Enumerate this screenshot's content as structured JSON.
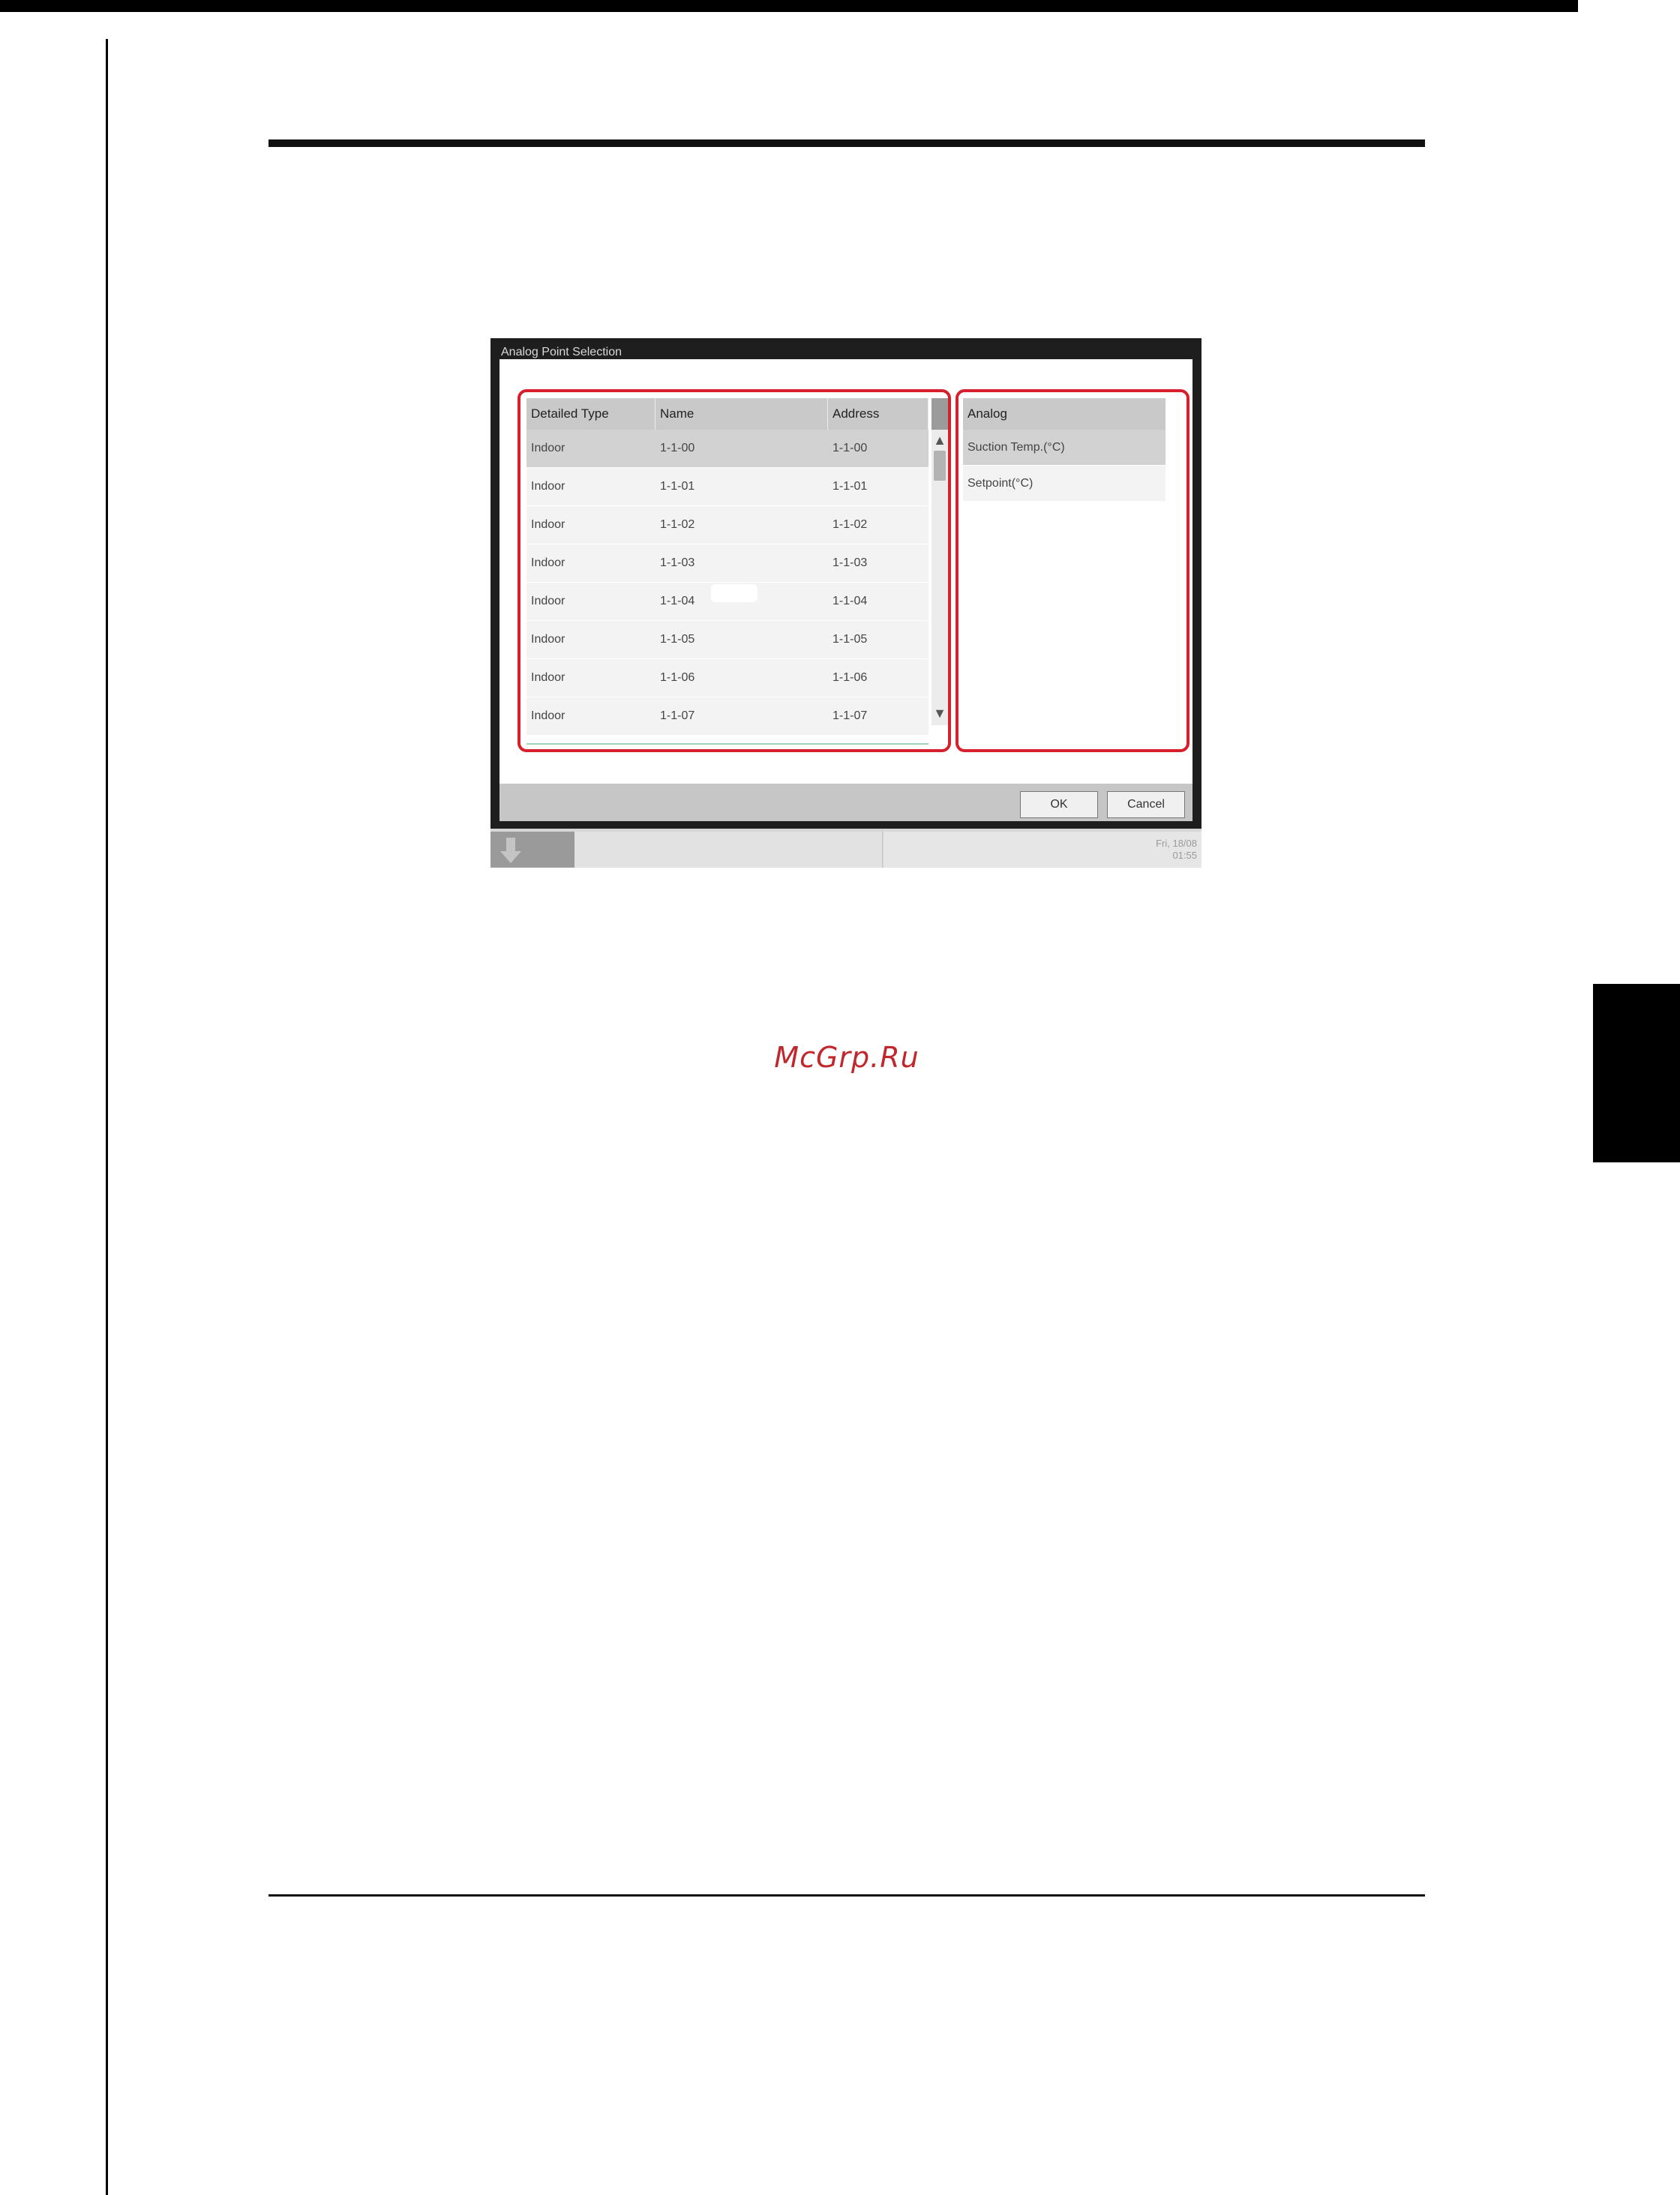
{
  "watermark": "McGrp.Ru",
  "dialog": {
    "title": "Analog Point Selection",
    "table": {
      "columns": [
        "Detailed Type",
        "Name",
        "Address"
      ],
      "rows": [
        [
          "Indoor",
          "1-1-00",
          "1-1-00"
        ],
        [
          "Indoor",
          "1-1-01",
          "1-1-01"
        ],
        [
          "Indoor",
          "1-1-02",
          "1-1-02"
        ],
        [
          "Indoor",
          "1-1-03",
          "1-1-03"
        ],
        [
          "Indoor",
          "1-1-04",
          "1-1-04"
        ],
        [
          "Indoor",
          "1-1-05",
          "1-1-05"
        ],
        [
          "Indoor",
          "1-1-06",
          "1-1-06"
        ],
        [
          "Indoor",
          "1-1-07",
          "1-1-07"
        ]
      ],
      "selected_row": 0
    },
    "analog": {
      "header": "Analog",
      "items": [
        "Suction Temp.(°C)",
        "Setpoint(°C)"
      ],
      "selected_item": 0
    },
    "ok_label": "OK",
    "cancel_label": "Cancel"
  },
  "taskbar": {
    "date": "Fri, 18/08",
    "time": "01:55"
  },
  "icons": {
    "scroll_up": "▲",
    "scroll_down": "▼",
    "taskbar_button": "down-arrow-icon"
  },
  "colors": {
    "highlight_outline": "#d6202c",
    "watermark": "#c0282d"
  }
}
